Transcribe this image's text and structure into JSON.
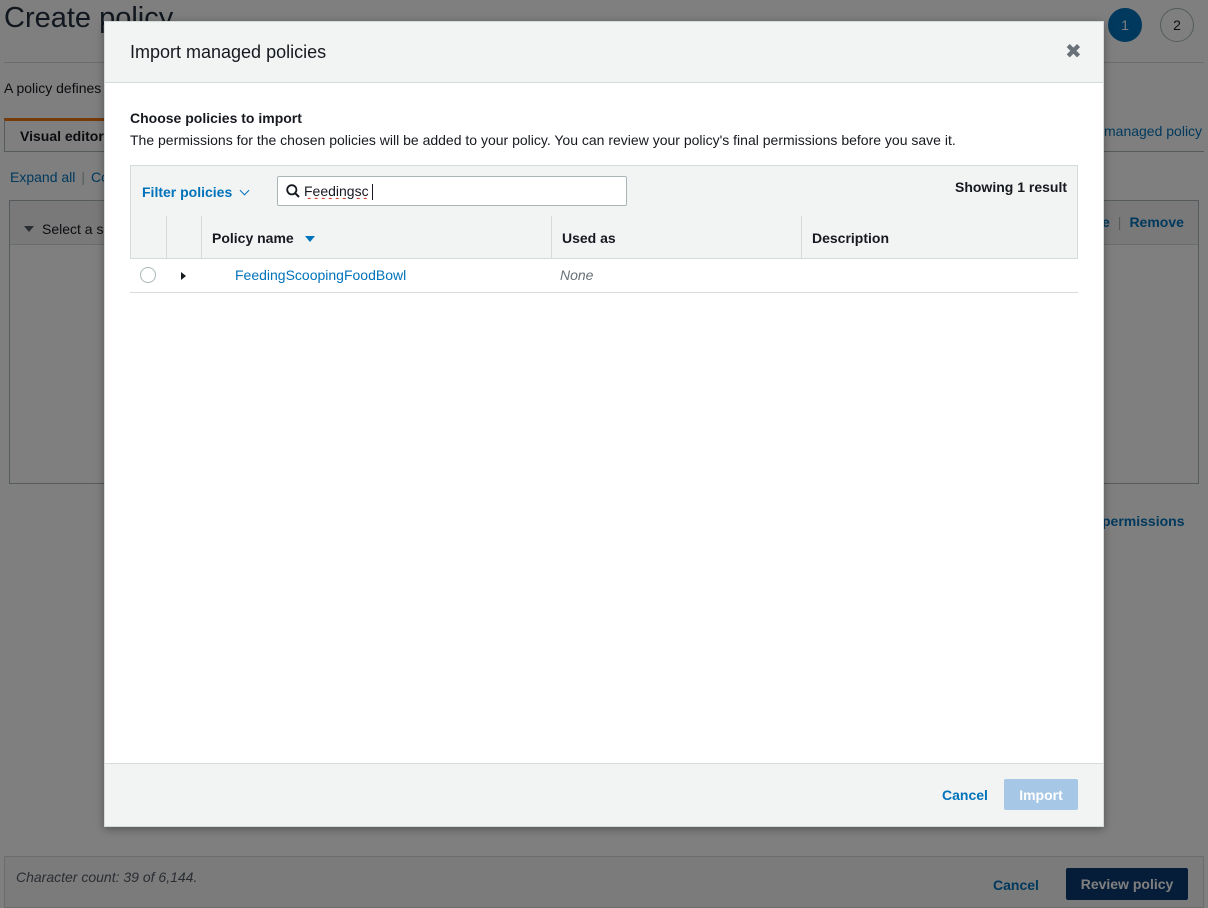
{
  "background": {
    "page_title": "Create policy",
    "steps": [
      "1",
      "2"
    ],
    "description": "A policy defines",
    "tab_visual_editor": "Visual editor",
    "import_link": "managed policy",
    "expand_all": "Expand all",
    "collapse_partial": "Co",
    "service_select": "Select a s",
    "clone_partial": "e",
    "remove": "Remove",
    "add_permissions": "permissions",
    "character_count": "Character count: 39 of 6,144.",
    "cancel": "Cancel",
    "review_policy": "Review policy"
  },
  "modal": {
    "title": "Import managed policies",
    "close_glyph": "✖",
    "section_title": "Choose policies to import",
    "section_desc": "The permissions for the chosen policies will be added to your policy. You can review your policy's final permissions before you save it.",
    "filter_label": "Filter policies",
    "search_value": "Feedingsc",
    "showing": "Showing 1 result",
    "columns": [
      "Policy name",
      "Used as",
      "Description"
    ],
    "rows": [
      {
        "name": "FeedingScoopingFoodBowl",
        "used_as": "None",
        "description": ""
      }
    ],
    "cancel": "Cancel",
    "import": "Import"
  },
  "colors": {
    "link": "#0073bb",
    "primary_button": "#0d3b73",
    "disabled_button": "#a6c8e6",
    "accent_tab": "#ec7211"
  },
  "icons": {
    "search": "search-icon",
    "close": "close-icon",
    "filter_dropdown": "chevron-down-icon",
    "sort": "sort-desc-icon",
    "expand_row": "caret-right-icon"
  }
}
